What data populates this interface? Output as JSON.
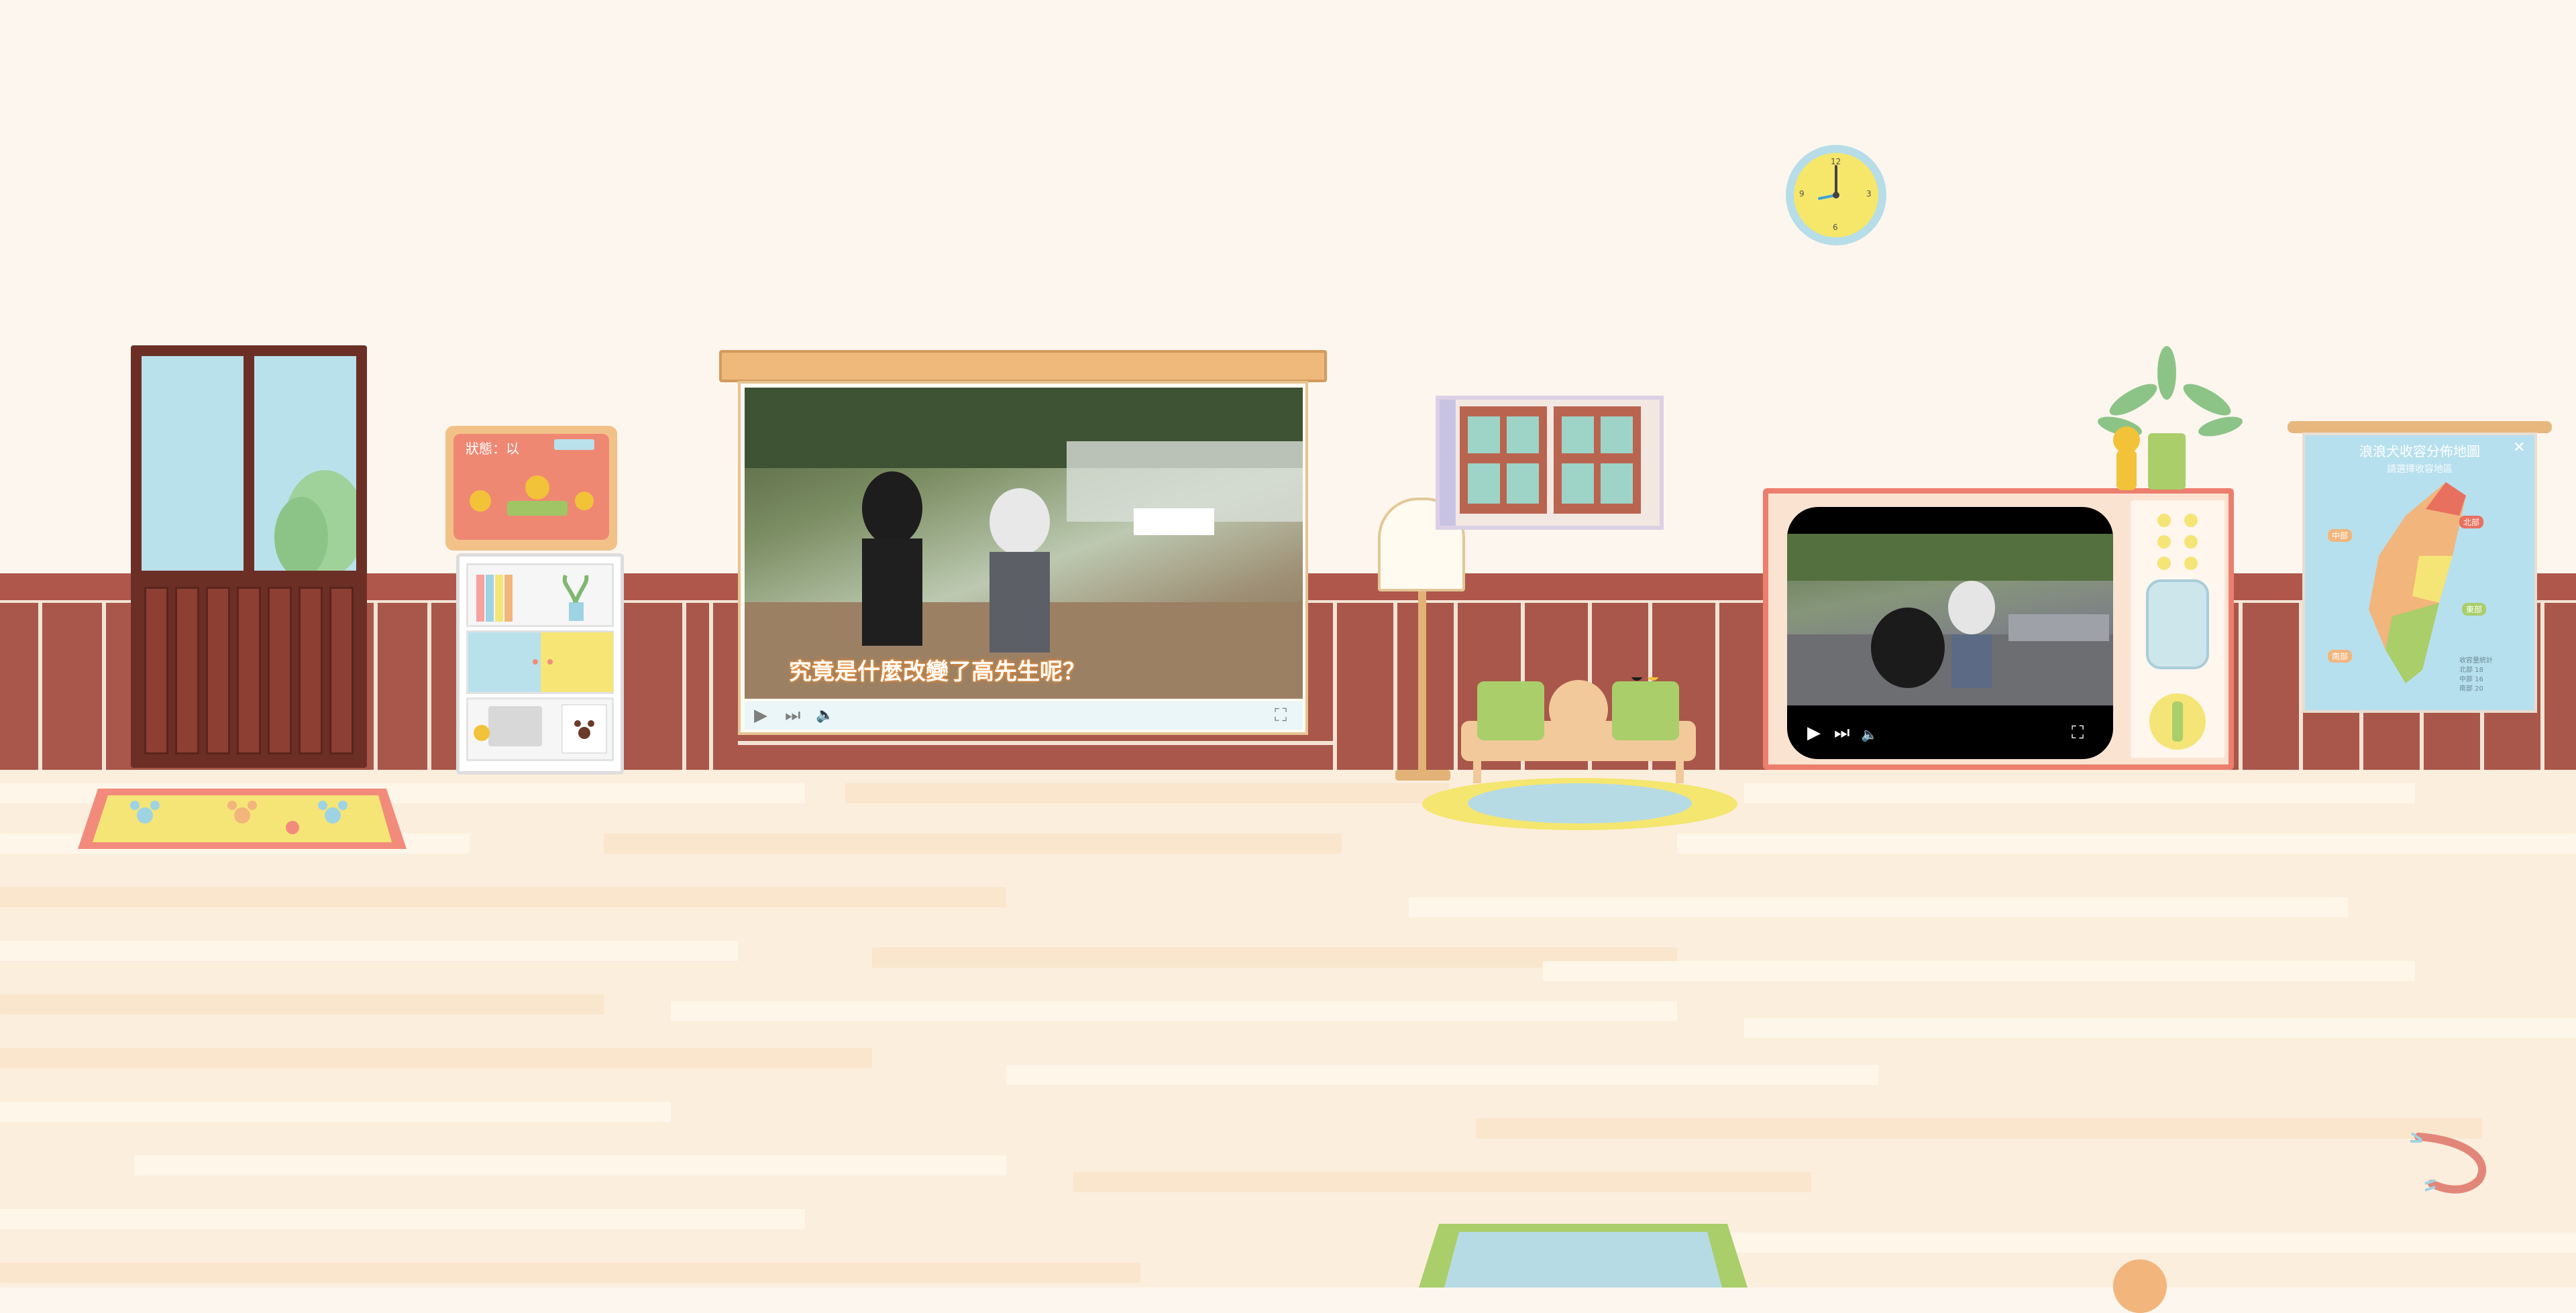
{
  "room": {
    "wall_color": "#fdf6ee",
    "wainscot_color": "#a9574a",
    "floor_color": "#fbeedd"
  },
  "frame": {
    "title": "狀態：以",
    "badge": "████"
  },
  "projector": {
    "subtitle": "究竟是什麼改變了高先生呢？",
    "controls": {
      "play_icon": "▶",
      "next_icon": "⏭",
      "volume_icon": "🔈",
      "fullscreen_icon": "⛶"
    }
  },
  "tv": {
    "controls": {
      "play_icon": "▶",
      "next_icon": "⏭",
      "volume_icon": "🔈",
      "fullscreen_icon": "⛶"
    }
  },
  "map": {
    "title": "浪浪犬收容分佈地圖",
    "subtitle": "請選擇收容地區",
    "close_icon": "✕",
    "regions": [
      "北部",
      "中部",
      "南部",
      "東部"
    ],
    "legend": [
      "收容量統計",
      "北部 18",
      "中部 16",
      "南部 20"
    ]
  },
  "clock": {
    "hour_marks": [
      "12",
      "3",
      "6",
      "9"
    ]
  },
  "colors": {
    "accent_orange": "#ef8873",
    "accent_yellow": "#f6e76a",
    "accent_green": "#a9ce6a",
    "accent_blue": "#b7e0ee"
  }
}
